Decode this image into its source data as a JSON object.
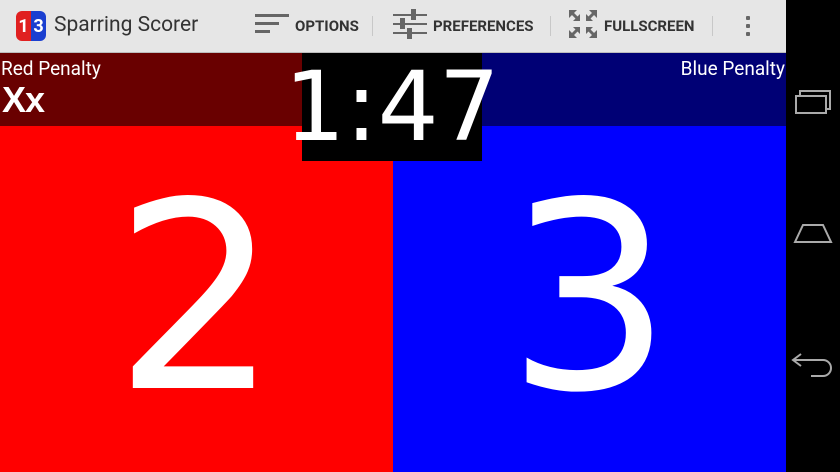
{
  "app": {
    "icon_left": "1",
    "icon_right": "3",
    "title": "Sparring Scorer"
  },
  "actions": {
    "options": "OPTIONS",
    "preferences": "PREFERENCES",
    "fullscreen": "FULLSCREEN"
  },
  "red": {
    "penalty_label": "Red Penalty",
    "penalty_marks": "Xx",
    "score": "2"
  },
  "blue": {
    "penalty_label": "Blue Penalty",
    "score": "3"
  },
  "timer": "1:47",
  "colors": {
    "red_score_bg": "#ff0000",
    "red_penalty_bg": "#690000",
    "blue_score_bg": "#0000ff",
    "blue_penalty_bg": "#000075",
    "actionbar_bg": "#e6e6e6"
  },
  "icons": [
    "options-icon",
    "preferences-icon",
    "fullscreen-icon",
    "overflow-menu-icon",
    "recent-apps-icon",
    "home-icon",
    "back-icon"
  ]
}
